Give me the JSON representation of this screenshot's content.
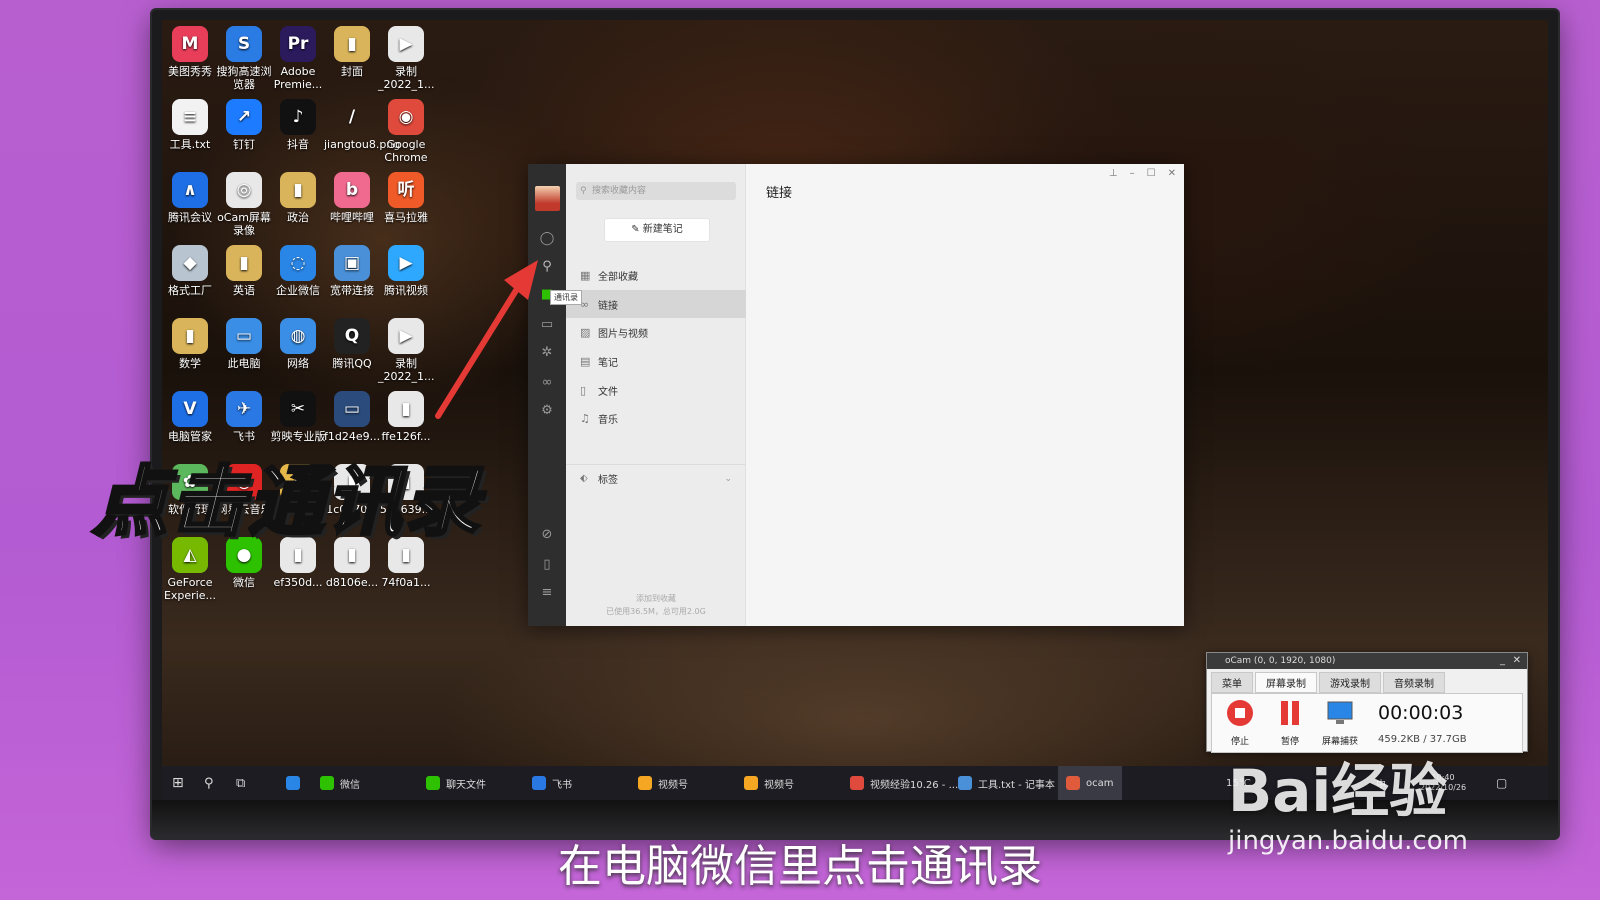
{
  "desktop_icons": [
    {
      "label": "美图秀秀",
      "color": "#e83e5a",
      "glyph": "M"
    },
    {
      "label": "搜狗高速浏览器",
      "color": "#2a7be4",
      "glyph": "S"
    },
    {
      "label": "Adobe Premie...",
      "color": "#2b1a5c",
      "glyph": "Pr"
    },
    {
      "label": "封面",
      "color": "#d9b45a",
      "glyph": "▮"
    },
    {
      "label": "录制_2022_1...",
      "color": "#e8e8e8",
      "glyph": "▶"
    },
    {
      "label": "工具.txt",
      "color": "#f2f2f2",
      "glyph": "≡"
    },
    {
      "label": "钉钉",
      "color": "#1d7bff",
      "glyph": "↗"
    },
    {
      "label": "抖音",
      "color": "#111111",
      "glyph": "♪"
    },
    {
      "label": "jiangtou8.png",
      "color": "transparent",
      "glyph": "/"
    },
    {
      "label": "Google Chrome",
      "color": "#e04a3c",
      "glyph": "◉"
    },
    {
      "label": "腾讯会议",
      "color": "#1e6fe6",
      "glyph": "∧"
    },
    {
      "label": "oCam屏幕录像",
      "color": "#e8e8e8",
      "glyph": "◎"
    },
    {
      "label": "政治",
      "color": "#d9b45a",
      "glyph": "▮"
    },
    {
      "label": "哔哩哔哩",
      "color": "#f06a8f",
      "glyph": "b"
    },
    {
      "label": "喜马拉雅",
      "color": "#f05a28",
      "glyph": "听"
    },
    {
      "label": "格式工厂",
      "color": "#b8c4d0",
      "glyph": "◆"
    },
    {
      "label": "英语",
      "color": "#d9b45a",
      "glyph": "▮"
    },
    {
      "label": "企业微信",
      "color": "#2a86e6",
      "glyph": "◌"
    },
    {
      "label": "宽带连接",
      "color": "#4a90d9",
      "glyph": "▣"
    },
    {
      "label": "腾讯视频",
      "color": "#2ea8ff",
      "glyph": "▶"
    },
    {
      "label": "数学",
      "color": "#d9b45a",
      "glyph": "▮"
    },
    {
      "label": "此电脑",
      "color": "#3a8ee6",
      "glyph": "▭"
    },
    {
      "label": "网络",
      "color": "#3a8ee6",
      "glyph": "◍"
    },
    {
      "label": "腾讯QQ",
      "color": "#222222",
      "glyph": "Q"
    },
    {
      "label": "录制_2022_1...",
      "color": "#e8e8e8",
      "glyph": "▶"
    },
    {
      "label": "电脑管家",
      "color": "#1e6fe6",
      "glyph": "V"
    },
    {
      "label": "飞书",
      "color": "#2a78e4",
      "glyph": "✈"
    },
    {
      "label": "剪映专业版",
      "color": "#111111",
      "glyph": "✂"
    },
    {
      "label": "f1d24e9...",
      "color": "#2a4b7c",
      "glyph": "▭"
    },
    {
      "label": "ffe126f...",
      "color": "#e8e8e8",
      "glyph": "▮"
    },
    {
      "label": "软件管理",
      "color": "#5cb85c",
      "glyph": "✿"
    },
    {
      "label": "网易云音乐",
      "color": "#e02424",
      "glyph": "◎"
    },
    {
      "label": "新建文件夹",
      "color": "#e6b84a",
      "glyph": "▮"
    },
    {
      "label": "1c0470...",
      "color": "#e8e8e8",
      "glyph": "▮"
    },
    {
      "label": "5be639...",
      "color": "#e8e8e8",
      "glyph": "▮"
    },
    {
      "label": "GeForce Experie...",
      "color": "#76b900",
      "glyph": "◭"
    },
    {
      "label": "微信",
      "color": "#2dc100",
      "glyph": "●"
    },
    {
      "label": "ef350d...",
      "color": "#e8e8e8",
      "glyph": "▮"
    },
    {
      "label": "d8106e...",
      "color": "#e8e8e8",
      "glyph": "▮"
    },
    {
      "label": "74f0a1...",
      "color": "#e8e8e8",
      "glyph": "▮"
    }
  ],
  "overlay": {
    "big_caption": "点击通讯录",
    "sub_caption": "在电脑微信里点击通讯录",
    "arrow_color": "#e53935"
  },
  "wechat": {
    "search_placeholder": "搜索收藏内容",
    "new_note_label": "新建笔记",
    "menu": [
      {
        "icon": "grid-icon",
        "glyph": "▦",
        "label": "全部收藏",
        "active": false
      },
      {
        "icon": "link-icon",
        "glyph": "∞",
        "label": "链接",
        "active": true
      },
      {
        "icon": "image-icon",
        "glyph": "▨",
        "label": "图片与视频",
        "active": false
      },
      {
        "icon": "note-icon",
        "glyph": "▤",
        "label": "笔记",
        "active": false
      },
      {
        "icon": "file-icon",
        "glyph": "▯",
        "label": "文件",
        "active": false
      },
      {
        "icon": "music-icon",
        "glyph": "♫",
        "label": "音乐",
        "active": false
      }
    ],
    "tags_label": "标签",
    "footer_line1": "添加到收藏",
    "footer_line2": "已使用36.5M，总可用2.0G",
    "main_title": "链接",
    "tooltip": "通讯录",
    "sidebar_icons": [
      "chat-icon",
      "contacts-icon",
      "favorites-icon",
      "folder-icon",
      "moments-icon",
      "video-channel-icon",
      "settings-icon",
      "miniprogram-icon",
      "phone-icon",
      "more-icon"
    ]
  },
  "ocam": {
    "title": "oCam (0, 0, 1920, 1080)",
    "tabs": [
      "菜单",
      "屏幕录制",
      "游戏录制",
      "音频录制"
    ],
    "selected_tab": "屏幕录制",
    "stop_label": "停止",
    "pause_label": "暂停",
    "screen_label": "屏幕捕获",
    "timer": "00:00:03",
    "size": "459.2KB / 37.7GB"
  },
  "taskbar": {
    "items": [
      {
        "label": "微信",
        "color": "#2dc100"
      },
      {
        "label": "聊天文件",
        "color": "#2dc100"
      },
      {
        "label": "飞书",
        "color": "#2a78e4"
      },
      {
        "label": "视频号",
        "color": "#f5a623"
      },
      {
        "label": "视频号",
        "color": "#f5a623"
      },
      {
        "label": "视频经验10.26 - ...",
        "color": "#e04a3c"
      },
      {
        "label": "工具.txt - 记事本",
        "color": "#4a90d9"
      },
      {
        "label": "ocam",
        "color": "#e05a3c"
      }
    ],
    "tray_temp": "15°C",
    "tray_lang": "中",
    "clock_time": "10:40",
    "clock_date": "2022/10/26"
  },
  "watermark": {
    "brand": "Bai经验",
    "url": "jingyan.baidu.com"
  }
}
